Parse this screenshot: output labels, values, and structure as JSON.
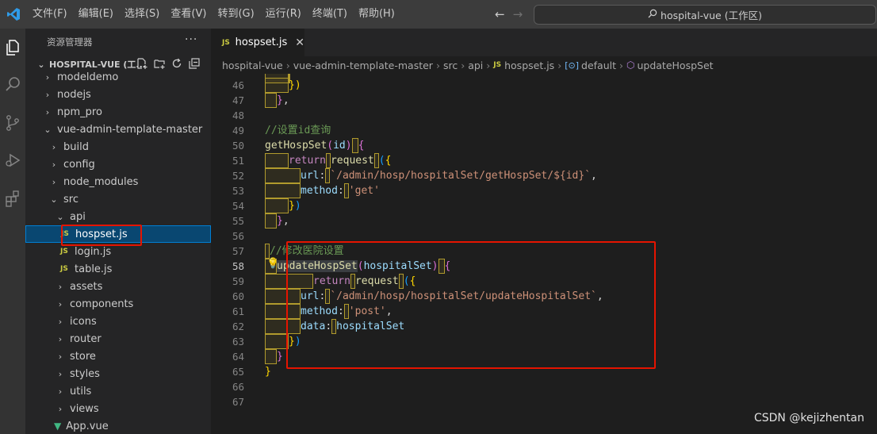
{
  "titlebar": {
    "menu": [
      "文件(F)",
      "编辑(E)",
      "选择(S)",
      "查看(V)",
      "转到(G)",
      "运行(R)",
      "终端(T)",
      "帮助(H)"
    ],
    "back": "←",
    "forward": "→",
    "search_text": "hospital-vue (工作区)"
  },
  "sidebar": {
    "title": "资源管理器",
    "more": "···",
    "section": "HOSPITAL-VUE (工...",
    "tree": [
      {
        "label": "modeldemo",
        "indent": 1,
        "kind": "folder",
        "open": false
      },
      {
        "label": "nodejs",
        "indent": 1,
        "kind": "folder",
        "open": false
      },
      {
        "label": "npm_pro",
        "indent": 1,
        "kind": "folder",
        "open": false
      },
      {
        "label": "vue-admin-template-master",
        "indent": 1,
        "kind": "folder",
        "open": true
      },
      {
        "label": "build",
        "indent": 2,
        "kind": "folder",
        "open": false
      },
      {
        "label": "config",
        "indent": 2,
        "kind": "folder",
        "open": false
      },
      {
        "label": "node_modules",
        "indent": 2,
        "kind": "folder",
        "open": false
      },
      {
        "label": "src",
        "indent": 2,
        "kind": "folder",
        "open": true
      },
      {
        "label": "api",
        "indent": 3,
        "kind": "folder",
        "open": true
      },
      {
        "label": "hospset.js",
        "indent": 4,
        "kind": "js",
        "selected": true
      },
      {
        "label": "login.js",
        "indent": 4,
        "kind": "js"
      },
      {
        "label": "table.js",
        "indent": 4,
        "kind": "js"
      },
      {
        "label": "assets",
        "indent": 3,
        "kind": "folder",
        "open": false
      },
      {
        "label": "components",
        "indent": 3,
        "kind": "folder",
        "open": false
      },
      {
        "label": "icons",
        "indent": 3,
        "kind": "folder",
        "open": false
      },
      {
        "label": "router",
        "indent": 3,
        "kind": "folder",
        "open": false
      },
      {
        "label": "store",
        "indent": 3,
        "kind": "folder",
        "open": false
      },
      {
        "label": "styles",
        "indent": 3,
        "kind": "folder",
        "open": false
      },
      {
        "label": "utils",
        "indent": 3,
        "kind": "folder",
        "open": false
      },
      {
        "label": "views",
        "indent": 3,
        "kind": "folder",
        "open": false
      },
      {
        "label": "App.vue",
        "indent": 3,
        "kind": "vue"
      }
    ]
  },
  "editor": {
    "tab_label": "hospset.js",
    "tab_icon": "JS",
    "breadcrumb": [
      "hospital-vue",
      "vue-admin-template-master",
      "src",
      "api",
      "hospset.js",
      "default",
      "updateHospSet"
    ],
    "line_numbers": [
      "46",
      "47",
      "48",
      "49",
      "50",
      "51",
      "52",
      "53",
      "54",
      "55",
      "56",
      "57",
      "58",
      "59",
      "60",
      "61",
      "62",
      "63",
      "64",
      "65",
      "66",
      "67"
    ],
    "active_line": "58",
    "code": {
      "l49": "//设置id查询",
      "l50_fn": "getHospSet",
      "l50_param": "id",
      "l51_kw": "return",
      "l51_fn": "request",
      "l52_key": "url",
      "l52_val": "`/admin/hosp/hospitalSet/getHospSet/${id}`",
      "l53_key": "method",
      "l53_val": "'get'",
      "l57": "//修改医院设置",
      "l58_fn": "updateHospSet",
      "l58_param": "hospitalSet",
      "l59_kw": "return",
      "l59_fn": "request",
      "l60_key": "url",
      "l60_val": "`/admin/hosp/hospitalSet/updateHospitalSet`",
      "l61_key": "method",
      "l61_val": "'post'",
      "l62_key": "data",
      "l62_val": "hospitalSet"
    }
  },
  "watermark": "CSDN @kejizhentan"
}
